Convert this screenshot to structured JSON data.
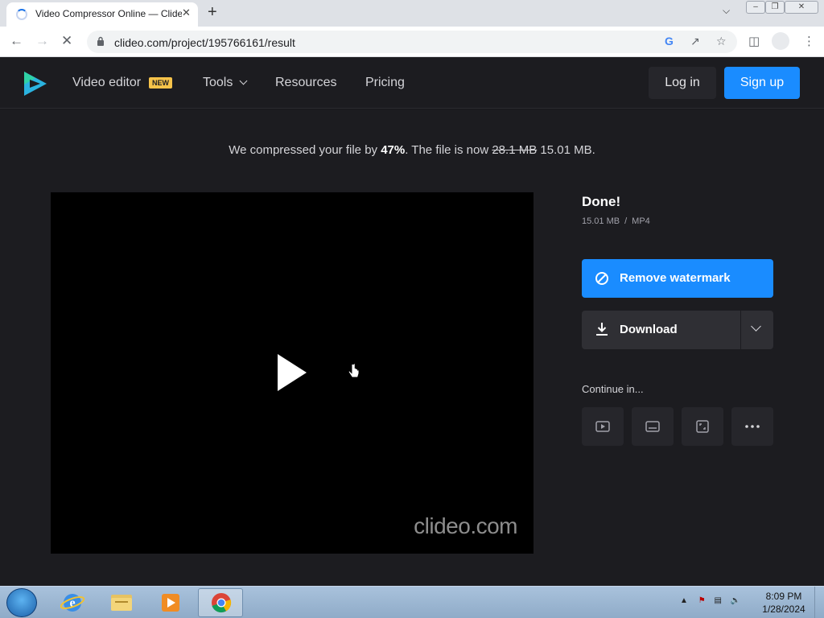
{
  "browser": {
    "tab_title": "Video Compressor Online — Clideo",
    "tab_close": "✕",
    "new_tab": "+",
    "url": "clideo.com/project/195766161/result"
  },
  "site": {
    "nav": {
      "video_editor": "Video editor",
      "new_badge": "NEW",
      "tools": "Tools",
      "resources": "Resources",
      "pricing": "Pricing",
      "login": "Log in",
      "signup": "Sign up"
    },
    "summary": {
      "prefix": "We compressed your file by ",
      "percent": "47%",
      "middle": ". The file is now ",
      "old_size": "28.1 MB",
      "new_size": " 15.01 MB."
    },
    "video": {
      "watermark": "clideo.com"
    },
    "result": {
      "title": "Done!",
      "size": "15.01 MB",
      "separator": "/",
      "format": "MP4",
      "remove_watermark": "Remove watermark",
      "download": "Download",
      "continue_label": "Continue in..."
    },
    "colors": {
      "accent": "#1a8cff",
      "background": "#1c1c20"
    }
  },
  "taskbar": {
    "time": "8:09 PM",
    "date": "1/28/2024",
    "apps": [
      "internet-explorer",
      "file-explorer",
      "media-player",
      "chrome"
    ]
  }
}
